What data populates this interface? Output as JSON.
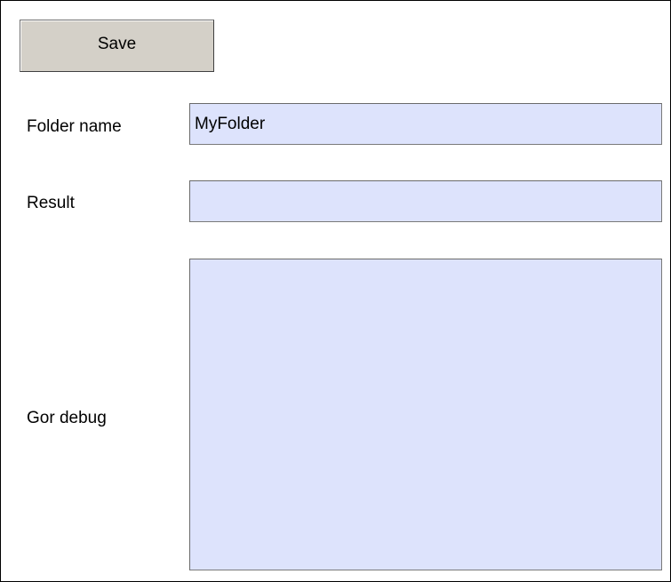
{
  "toolbar": {
    "save_label": "Save"
  },
  "form": {
    "folder_name": {
      "label": "Folder name",
      "value": "MyFolder"
    },
    "result": {
      "label": "Result",
      "value": ""
    },
    "debug": {
      "label": "Gor debug",
      "value": ""
    }
  },
  "colors": {
    "button_face": "#d4d0c8",
    "field_background": "#dde3fc",
    "frame_border": "#000000"
  }
}
